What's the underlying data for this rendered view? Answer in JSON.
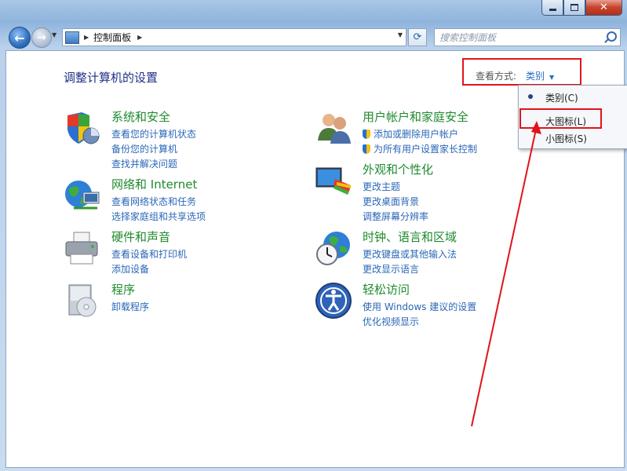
{
  "address": {
    "crumb": "控制面板"
  },
  "search": {
    "placeholder": "搜索控制面板"
  },
  "main": {
    "title": "调整计算机的设置",
    "view_by_label": "查看方式:",
    "view_by_value": "类别"
  },
  "menu": {
    "items": [
      {
        "label": "类别(C)",
        "selected": true
      },
      {
        "label": "大图标(L)"
      },
      {
        "label": "小图标(S)"
      }
    ]
  },
  "categories": [
    {
      "title": "系统和安全",
      "links": [
        "查看您的计算机状态",
        "备份您的计算机",
        "查找并解决问题"
      ]
    },
    {
      "title": "网络和 Internet",
      "links": [
        "查看网络状态和任务",
        "选择家庭组和共享选项"
      ]
    },
    {
      "title": "硬件和声音",
      "links": [
        "查看设备和打印机",
        "添加设备"
      ]
    },
    {
      "title": "程序",
      "links": [
        "卸载程序"
      ]
    },
    {
      "title": "用户帐户和家庭安全",
      "links": [
        "添加或删除用户帐户",
        "为所有用户设置家长控制"
      ]
    },
    {
      "title": "外观和个性化",
      "links": [
        "更改主题",
        "更改桌面背景",
        "调整屏幕分辨率"
      ]
    },
    {
      "title": "时钟、语言和区域",
      "links": [
        "更改键盘或其他输入法",
        "更改显示语言"
      ]
    },
    {
      "title": "轻松访问",
      "links": [
        "使用 Windows 建议的设置",
        "优化视频显示"
      ]
    }
  ],
  "icons": {
    "system_security": "shield-chart-icon",
    "network": "globe-network-icon",
    "hardware": "printer-icon",
    "programs": "cd-box-icon",
    "users": "users-icon",
    "appearance": "monitor-palette-icon",
    "clock": "globe-clock-icon",
    "ease": "ease-of-access-icon"
  },
  "colors": {
    "annotation_red": "#e2131a",
    "category_green": "#1e8a2e",
    "link_blue": "#2a67b7"
  }
}
